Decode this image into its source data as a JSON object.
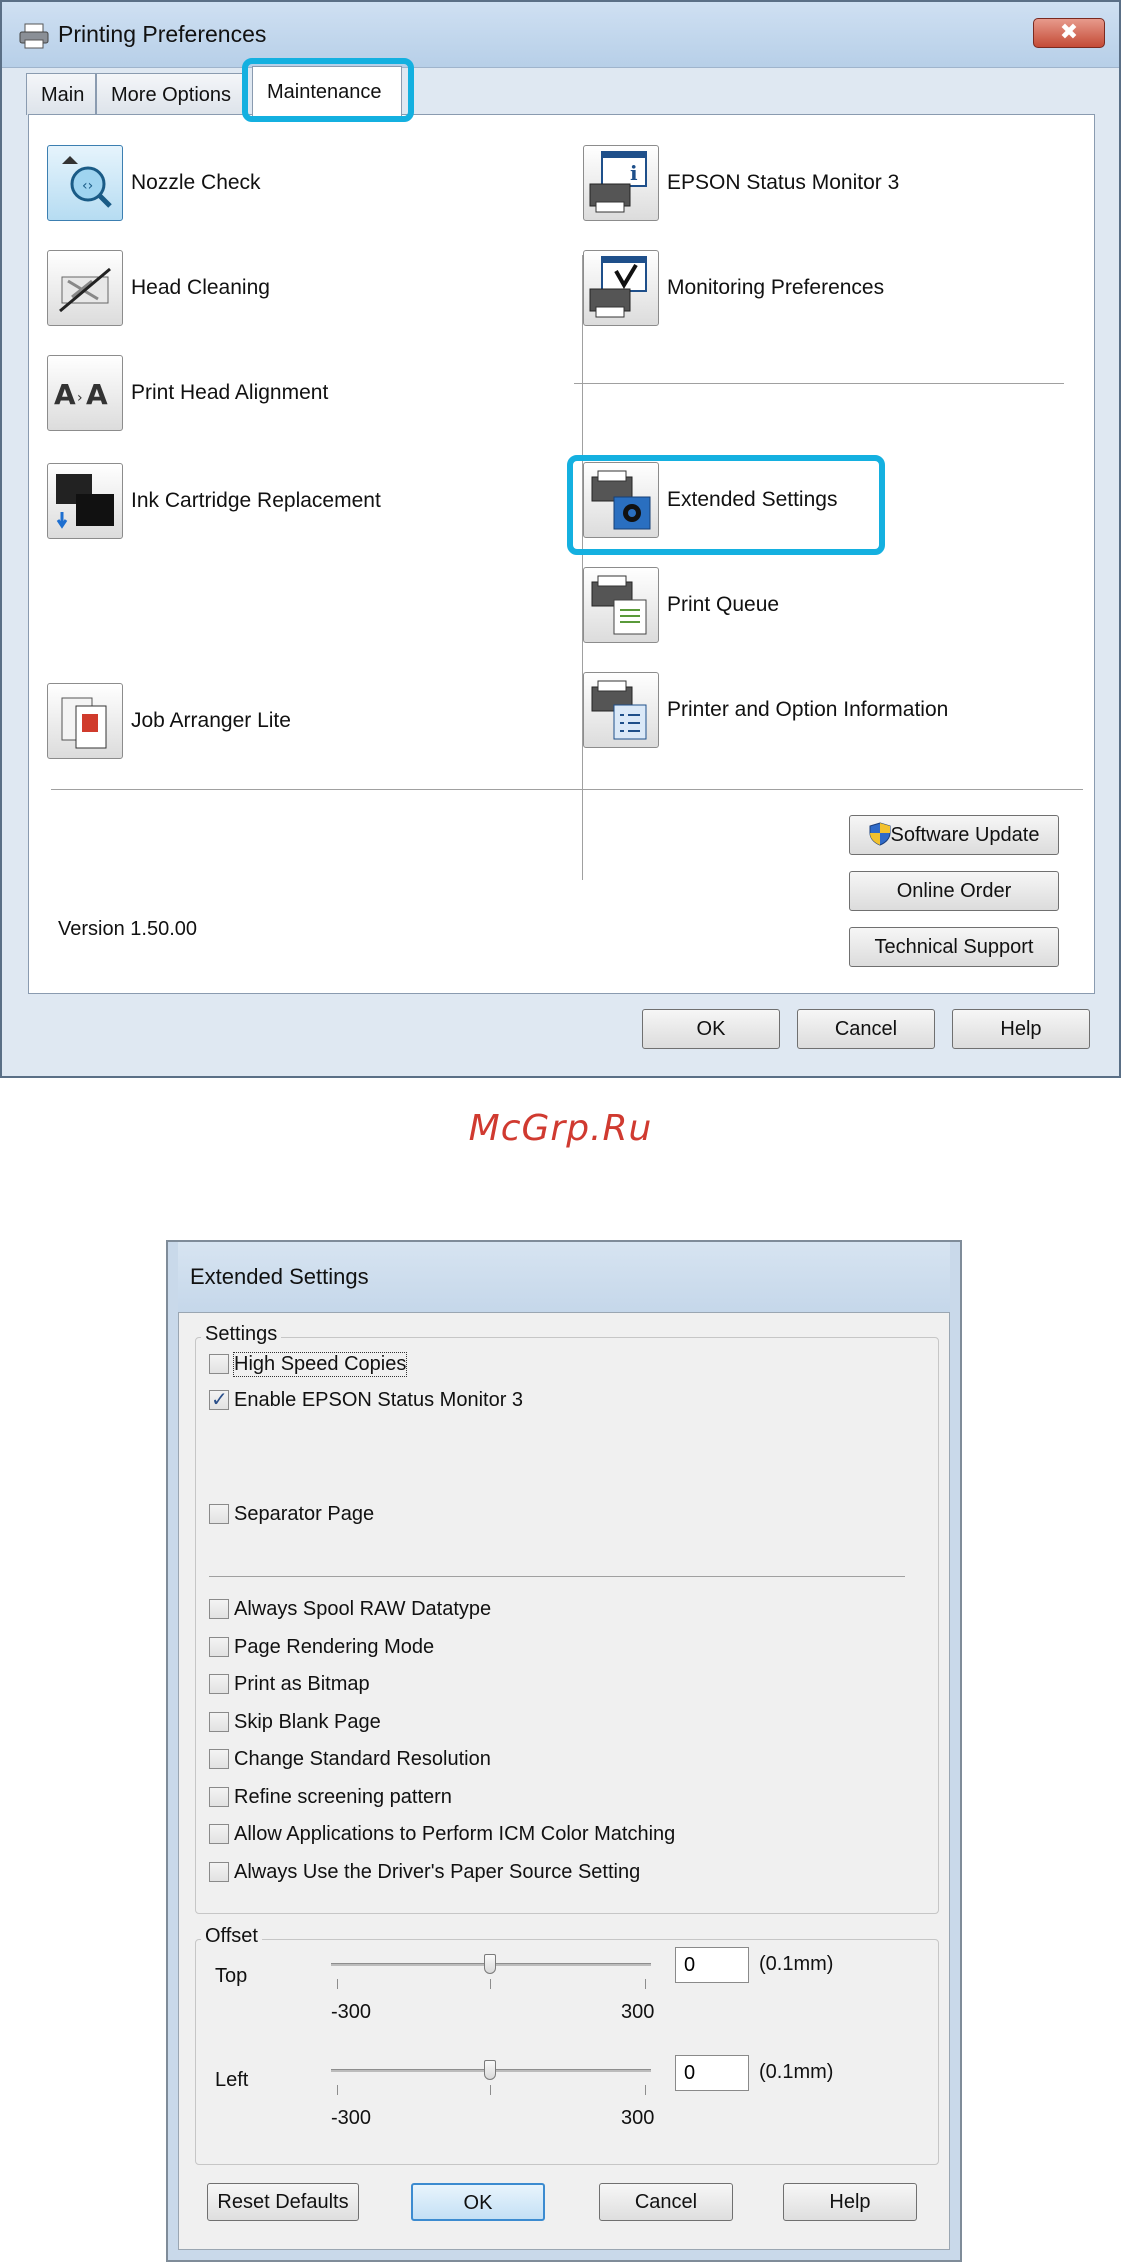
{
  "window1": {
    "title": "Printing Preferences",
    "close_label": "✖",
    "tabs": [
      {
        "label": "Main",
        "active": false
      },
      {
        "label": "More Options",
        "active": false
      },
      {
        "label": "Maintenance",
        "active": true
      }
    ],
    "left_items": [
      {
        "label": "Nozzle Check",
        "icon": "nozzle-check-icon"
      },
      {
        "label": "Head Cleaning",
        "icon": "head-cleaning-icon"
      },
      {
        "label": "Print Head Alignment",
        "icon": "head-alignment-icon"
      },
      {
        "label": "Ink Cartridge Replacement",
        "icon": "ink-cartridge-icon"
      },
      {
        "label": "Job Arranger Lite",
        "icon": "job-arranger-icon"
      }
    ],
    "right_items": [
      {
        "label": "EPSON Status Monitor 3",
        "icon": "status-monitor-icon"
      },
      {
        "label": "Monitoring Preferences",
        "icon": "monitoring-preferences-icon"
      },
      {
        "label": "Extended Settings",
        "icon": "extended-settings-icon"
      },
      {
        "label": "Print Queue",
        "icon": "print-queue-icon"
      },
      {
        "label": "Printer and Option Information",
        "icon": "printer-information-icon"
      }
    ],
    "version": "Version 1.50.00",
    "side_buttons": {
      "software_update": "Software Update",
      "online_order": "Online Order",
      "technical_support": "Technical Support"
    },
    "footer_buttons": {
      "ok": "OK",
      "cancel": "Cancel",
      "help": "Help"
    },
    "highlight_color": "#14b0e0"
  },
  "watermark": "McGrp.Ru",
  "window2": {
    "title": "Extended Settings",
    "settings_group_title": "Settings",
    "checkboxes_top": [
      {
        "label": "High Speed Copies",
        "checked": false
      },
      {
        "label": "Enable EPSON Status Monitor 3",
        "checked": true
      },
      {
        "label": "Separator Page",
        "checked": false
      }
    ],
    "checkboxes_bottom": [
      {
        "label": "Always Spool RAW Datatype",
        "checked": false
      },
      {
        "label": "Page Rendering Mode",
        "checked": false
      },
      {
        "label": "Print as Bitmap",
        "checked": false
      },
      {
        "label": "Skip Blank Page",
        "checked": false
      },
      {
        "label": "Change Standard Resolution",
        "checked": false
      },
      {
        "label": "Refine screening pattern",
        "checked": false
      },
      {
        "label": "Allow Applications to Perform ICM Color Matching",
        "checked": false
      },
      {
        "label": "Always Use the Driver's Paper Source Setting",
        "checked": false
      }
    ],
    "offset_group_title": "Offset",
    "offset": {
      "top": {
        "label": "Top",
        "value": "0",
        "min": "-300",
        "max": "300",
        "unit": "(0.1mm)"
      },
      "left": {
        "label": "Left",
        "value": "0",
        "min": "-300",
        "max": "300",
        "unit": "(0.1mm)"
      }
    },
    "buttons": {
      "reset": "Reset Defaults",
      "ok": "OK",
      "cancel": "Cancel",
      "help": "Help"
    }
  }
}
